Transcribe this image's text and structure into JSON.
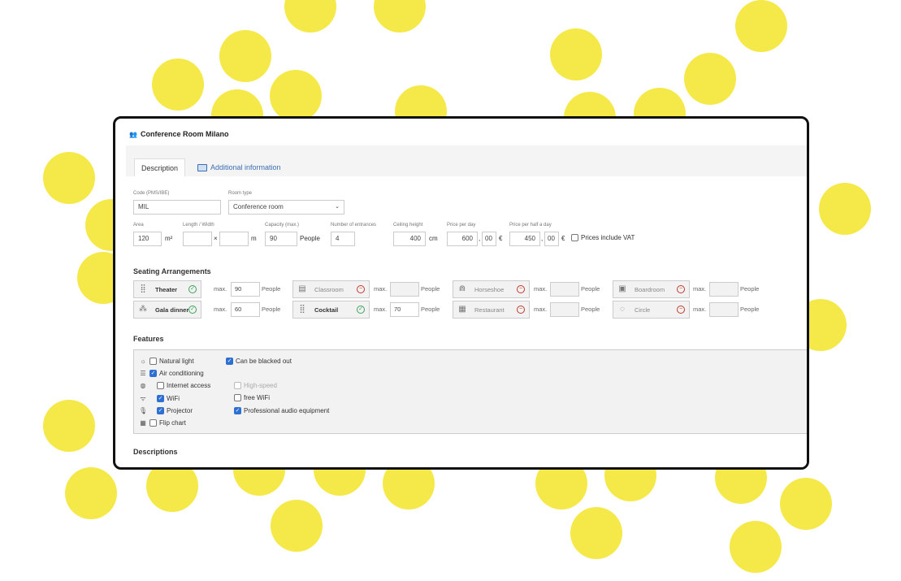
{
  "card_title": "Conference Room Milano",
  "tabs": {
    "description": "Description",
    "additional": "Additional information"
  },
  "labels": {
    "code": "Code (PMS/IBE)",
    "room_type": "Room type",
    "area": "Area",
    "length_width": "Length / Width",
    "capacity": "Capacity (max.)",
    "entrances": "Number of entrances",
    "ceiling": "Ceiling height",
    "price_day": "Price per day",
    "price_half": "Price per half a day"
  },
  "fields": {
    "code": "MIL",
    "room_type": "Conference room",
    "area": "120",
    "area_unit": "m²",
    "times": "×",
    "lw_unit": "m",
    "capacity": "90",
    "capacity_unit": "People",
    "entrances": "4",
    "ceiling": "400",
    "ceiling_unit": "cm",
    "price_day": "600",
    "price_day_dec": "00",
    "price_half": "450",
    "price_half_dec": "00",
    "currency": "€",
    "decimal_sep": ",",
    "vat": "Prices include VAT"
  },
  "seating": {
    "title": "Seating Arrangements",
    "max_label": "max.",
    "people": "People",
    "items": [
      {
        "name": "Theater",
        "active": true,
        "value": "90"
      },
      {
        "name": "Classroom",
        "active": false,
        "value": ""
      },
      {
        "name": "Horseshoe",
        "active": false,
        "value": ""
      },
      {
        "name": "Boardroom",
        "active": false,
        "value": ""
      },
      {
        "name": "Gala dinner",
        "active": true,
        "value": "60"
      },
      {
        "name": "Cocktail",
        "active": true,
        "value": "70"
      },
      {
        "name": "Restaurant",
        "active": false,
        "value": ""
      },
      {
        "name": "Circle",
        "active": false,
        "value": ""
      }
    ]
  },
  "features": {
    "title": "Features",
    "natural_light": "Natural light",
    "blackout": "Can be blacked out",
    "air": "Air conditioning",
    "internet": "Internet access",
    "highspeed": "High-speed",
    "wifi": "WiFi",
    "free_wifi": "free WiFi",
    "projector": "Projector",
    "audio": "Professional audio equipment",
    "flip": "Flip chart"
  },
  "descriptions_title": "Descriptions",
  "colors": {
    "dot": "#f5e94a",
    "link": "#3b6db3",
    "check": "#2e6fd2",
    "ok": "#3aa35a",
    "no": "#c0392b"
  }
}
